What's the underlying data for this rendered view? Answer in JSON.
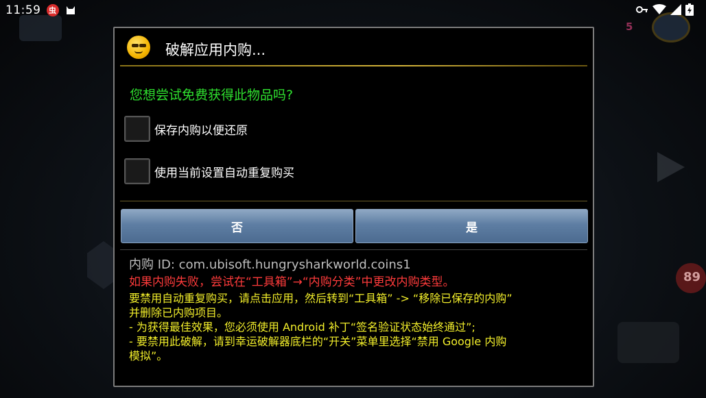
{
  "status_bar": {
    "time": "11:59",
    "app_icon_text": "虫",
    "icons": [
      "notification-app-icon",
      "cat-icon",
      "key-icon",
      "wifi-icon",
      "signal-icon",
      "battery-icon"
    ]
  },
  "background": {
    "lives_text": "5",
    "heart_text": "89"
  },
  "dialog": {
    "title": "破解应用内购...",
    "title_icon": "smiley-sunglasses-icon",
    "question": "您想尝试免费获得此物品吗?",
    "checkboxes": [
      {
        "label": "保存内购以便还原",
        "checked": false
      },
      {
        "label": "使用当前设置自动重复购买",
        "checked": false
      }
    ],
    "buttons": {
      "no": "否",
      "yes": "是"
    },
    "info": {
      "purchase_id": "内购 ID: com.ubisoft.hungrysharkworld.coins1",
      "red_note": "如果内购失败，尝试在“工具箱”→“内购分类”中更改内购类型。",
      "yellow_lines": [
        "要禁用自动重复购买，请点击应用，然后转到“工具箱” -> “移除已保存的内购”",
        "并删除已内购项目。",
        "- 为获得最佳效果，您必须使用 Android 补丁“签名验证状态始终通过”;",
        "- 要禁用此破解，请到幸运破解器底栏的“开关”菜单里选择“禁用 Google 内购",
        "模拟”。"
      ]
    }
  },
  "colors": {
    "question_green": "#2fe12f",
    "note_red": "#ff3b3b",
    "note_yellow": "#f3ef2b",
    "button_blue": "#5e7ea3",
    "rule_gold": "#d4b43a"
  }
}
